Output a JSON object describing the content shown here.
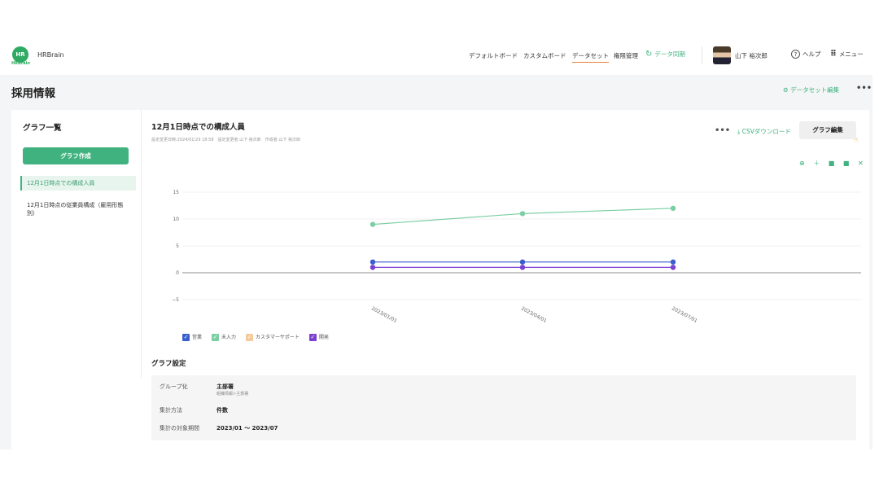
{
  "header": {
    "logo_text": "HR",
    "logo_sub": "HRBrain",
    "brand": "HRBrain",
    "nav": [
      "デフォルトボード",
      "カスタムボード",
      "データセット",
      "権限管理"
    ],
    "sync_label": "データ同期",
    "user_name": "山下 裕次郎",
    "help_label": "ヘルプ",
    "menu_label": "メニュー"
  },
  "page": {
    "title": "採用情報",
    "dataset_edit": "データセット編集",
    "more": "•••"
  },
  "sidebar": {
    "title": "グラフ一覧",
    "create_button": "グラフ作成",
    "items": [
      "12月1日時点での構成人員",
      "12月1日時点の従業員構成（雇用形態別）"
    ]
  },
  "content": {
    "chart_title": "12月1日時点での構成人員",
    "meta": "設定変更日時:2024/01/29 18:58　設定変更者:山下 裕次郎　作成者:山下 裕次郎",
    "more": "•••",
    "csv_label": "CSVダウンロード",
    "edit_button": "グラフ編集",
    "toolbox": "⊕ ＋ ■ ■ ✕"
  },
  "chart_data": {
    "type": "line",
    "x": [
      "2023/01/01",
      "2023/04/01",
      "2023/07/01"
    ],
    "series": [
      {
        "name": "営業",
        "values": [
          2,
          2,
          2
        ],
        "color": "#3a5fcd"
      },
      {
        "name": "未入力",
        "values": [
          9,
          11,
          12
        ],
        "color": "#7ccfa3"
      },
      {
        "name": "カスタマーサポート",
        "values": [
          null,
          null,
          null
        ],
        "color": "#f5c99a"
      },
      {
        "name": "開発",
        "values": [
          1,
          1,
          1
        ],
        "color": "#7b3fd1"
      }
    ],
    "yticks": [
      "15",
      "10",
      "5",
      "0",
      "−5"
    ],
    "ylim": [
      -5,
      15
    ],
    "grid": true,
    "legend": "bottom-left"
  },
  "settings": {
    "title": "グラフ設定",
    "rows": [
      {
        "label": "グループ化",
        "value": "主部署",
        "sub": "組織情報>主部署"
      },
      {
        "label": "集計方法",
        "value": "件数"
      },
      {
        "label": "集計の対象期間",
        "value": "2023/01 〜 2023/07"
      }
    ]
  }
}
